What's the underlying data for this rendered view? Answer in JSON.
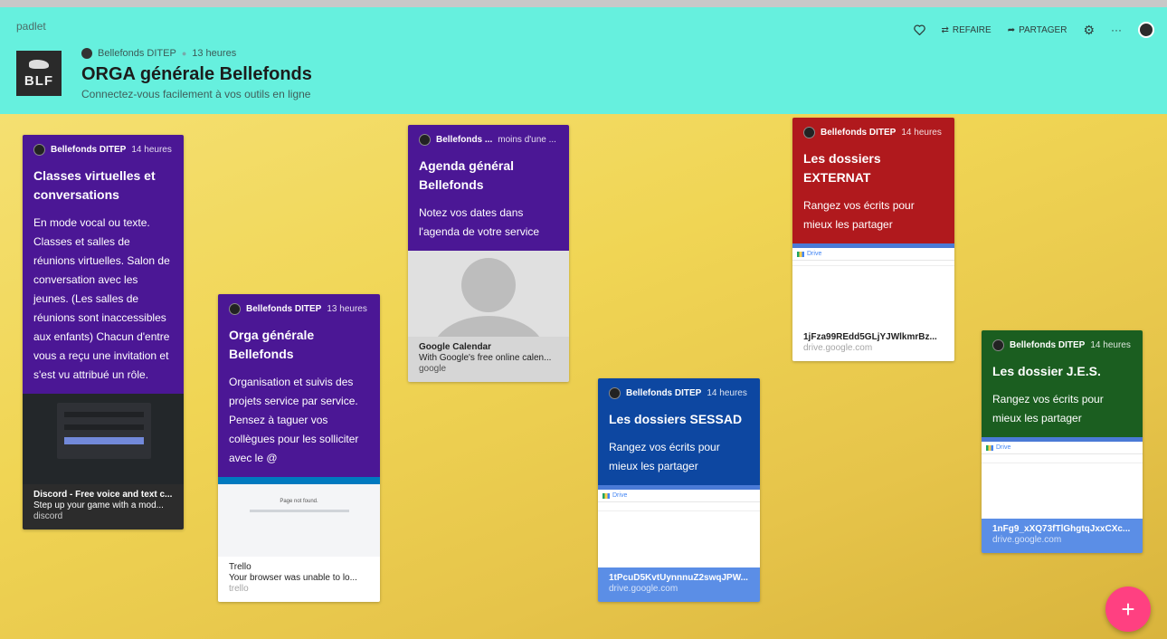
{
  "app": {
    "brand": "padlet"
  },
  "header": {
    "logo_text": "BLF",
    "author": "Bellefonds DITEP",
    "time": "13 heures",
    "title": "ORGA générale Bellefonds",
    "subtitle": "Connectez-vous facilement à vos outils en ligne",
    "actions": {
      "redo": "REFAIRE",
      "share": "PARTAGER",
      "more": "···"
    }
  },
  "colors": {
    "header": "#66f0de",
    "purple": "#4b1795",
    "red": "#b0191d",
    "blue": "#0d47a1",
    "green": "#1b5e20",
    "fab": "#ff4081"
  },
  "cards": [
    {
      "author": "Bellefonds DITEP",
      "time": "14 heures",
      "title": "Classes virtuelles et conversations",
      "body": "En mode vocal ou texte. Classes et salles de réunions virtuelles. Salon de conversation avec les jeunes. (Les salles de réunions sont inaccessibles aux enfants) Chacun d'entre vous a reçu une invitation et s'est vu attribué un rôle.",
      "link_title": "Discord - Free voice and text c...",
      "link_desc": "Step up your game with a mod...",
      "link_host": "discord"
    },
    {
      "author": "Bellefonds DITEP",
      "time": "13 heures",
      "title": "Orga générale Bellefonds",
      "body": "Organisation et suivis des projets service par service. Pensez à taguer vos collègues pour les solliciter avec le @",
      "preview_text": "Page not found.",
      "link_title": "Trello",
      "link_desc": "Your browser was unable to lo...",
      "link_host": "trello"
    },
    {
      "author": "Bellefonds ...",
      "time": "moins d'une ...",
      "title": "Agenda général Bellefonds",
      "body": "Notez vos dates dans l'agenda de votre service",
      "link_title": "Google Calendar",
      "link_desc": "With Google's free online calen...",
      "link_host": "google"
    },
    {
      "author": "Bellefonds DITEP",
      "time": "14 heures",
      "title": "Les dossiers SESSAD",
      "body": "Rangez vos écrits pour mieux les partager",
      "drive_label": "Drive",
      "link_title": "1tPcuD5KvtUynnnuZ2swqJPW...",
      "link_host": "drive.google.com"
    },
    {
      "author": "Bellefonds DITEP",
      "time": "14 heures",
      "title": "Les dossiers EXTERNAT",
      "body": "Rangez vos écrits pour mieux les partager",
      "drive_label": "Drive",
      "link_title": "1jFza99REdd5GLjYJWlkmrBz...",
      "link_host": "drive.google.com"
    },
    {
      "author": "Bellefonds DITEP",
      "time": "14 heures",
      "title": "Les dossier J.E.S.",
      "body": "Rangez vos écrits pour mieux les partager",
      "drive_label": "Drive",
      "link_title": "1nFg9_xXQ73fTlGhgtqJxxCXc...",
      "link_host": "drive.google.com"
    }
  ],
  "fab": "+"
}
